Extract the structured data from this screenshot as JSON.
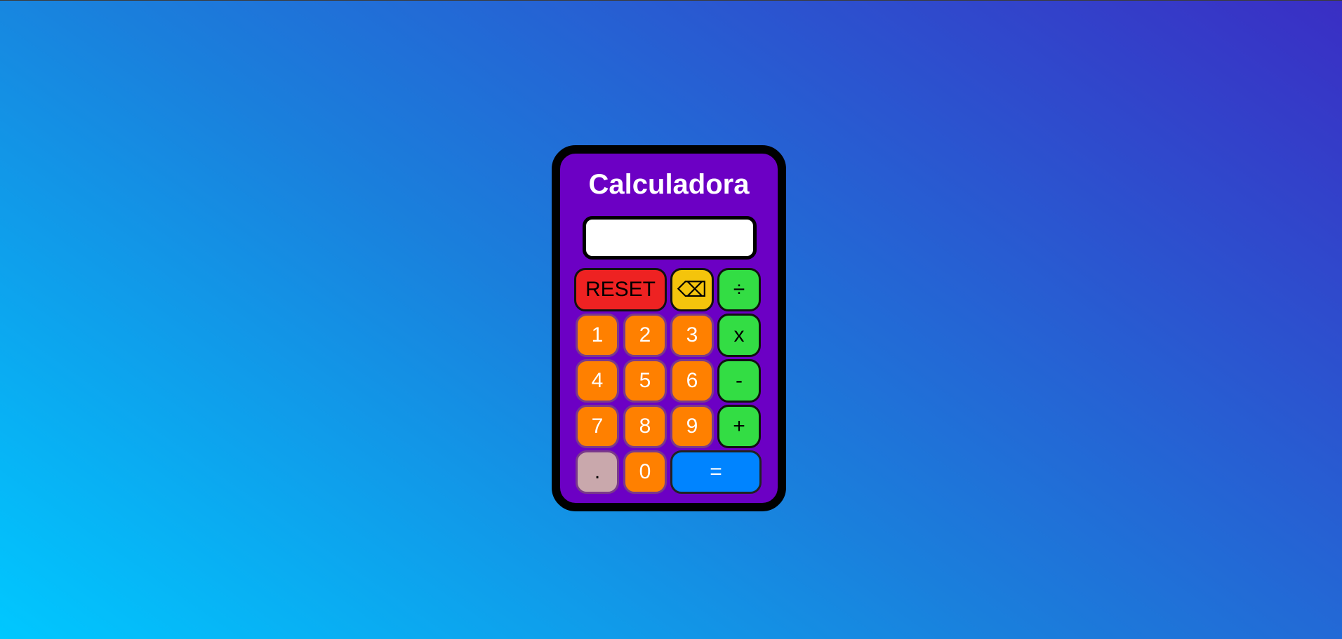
{
  "calculator": {
    "title": "Calculadora",
    "display_value": "",
    "keys": {
      "reset": "RESET",
      "backspace": "⌫",
      "divide": "÷",
      "multiply": "x",
      "subtract": "-",
      "add": "+",
      "equals": "=",
      "decimal": ".",
      "digits": {
        "d0": "0",
        "d1": "1",
        "d2": "2",
        "d3": "3",
        "d4": "4",
        "d5": "5",
        "d6": "6",
        "d7": "7",
        "d8": "8",
        "d9": "9"
      }
    },
    "colors": {
      "body": "#6c00c4",
      "digit": "#ff8000",
      "operator": "#33dd44",
      "reset": "#ee2222",
      "backspace": "#f4c40c",
      "decimal": "#c9a8ac",
      "equals": "#0084ff"
    }
  }
}
